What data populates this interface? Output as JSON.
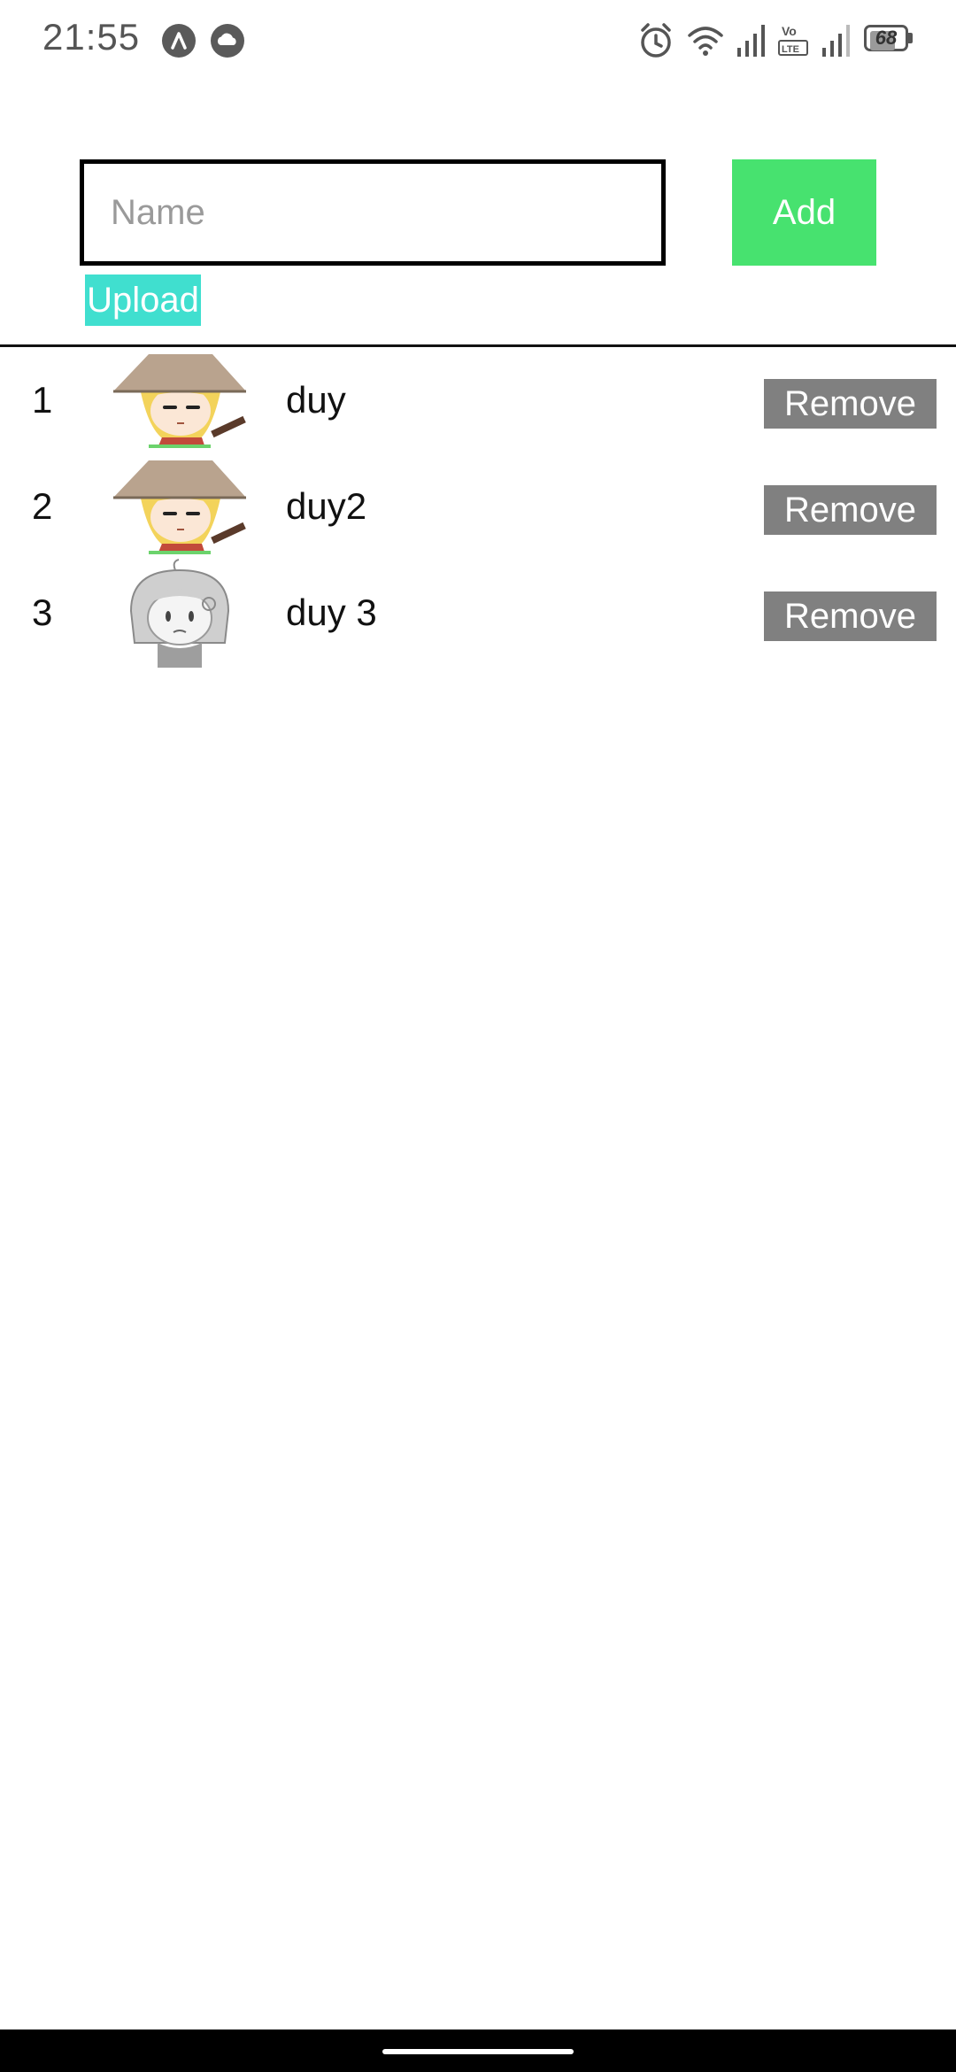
{
  "status_bar": {
    "time": "21:55",
    "battery_level": "68",
    "icons": [
      "app-notification-icon",
      "cloud-notification-icon",
      "alarm-icon",
      "wifi-icon",
      "signal-icon",
      "volte-icon",
      "battery-icon"
    ]
  },
  "form": {
    "name_placeholder": "Name",
    "name_value": "",
    "add_label": "Add",
    "upload_label": "Upload"
  },
  "list": {
    "items": [
      {
        "index": "1",
        "name": "duy",
        "remove_label": "Remove",
        "avatar": "blonde-girl-hat-avatar"
      },
      {
        "index": "2",
        "name": "duy2",
        "remove_label": "Remove",
        "avatar": "blonde-girl-hat-avatar"
      },
      {
        "index": "3",
        "name": "duy 3",
        "remove_label": "Remove",
        "avatar": "grey-girl-avatar"
      }
    ]
  },
  "colors": {
    "add_button": "#47e26f",
    "upload_button": "#40dfcf",
    "remove_button": "#808080"
  }
}
